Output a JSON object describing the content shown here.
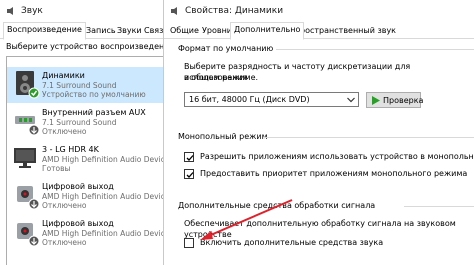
{
  "sound_window": {
    "title": "Звук",
    "tabs": [
      {
        "label": "Воспроизведение",
        "active": true
      },
      {
        "label": "Запись",
        "active": false
      },
      {
        "label": "Звуки",
        "active": false
      },
      {
        "label": "Связь",
        "active": false
      }
    ],
    "select_label": "Выберите устройство воспроизведения, па",
    "devices": [
      {
        "name": "Динамики",
        "line1": "7.1 Surround Sound",
        "line2": "Устройство по умолчанию",
        "icon": "speaker-icon",
        "selected": true
      },
      {
        "name": "Внутренний разъем AUX",
        "line1": "7.1 Surround Sound",
        "line2": "Отключено",
        "icon": "aux-icon",
        "selected": false
      },
      {
        "name": "3 - LG HDR 4K",
        "line1": "AMD High Definition Audio Device",
        "line2": "Готовы",
        "icon": "monitor-icon",
        "selected": false
      },
      {
        "name": "Цифровой выход",
        "line1": "AMD High Definition Audio Device",
        "line2": "Отключено",
        "icon": "digital-output-icon",
        "selected": false
      },
      {
        "name": "Цифровой выход",
        "line1": "AMD High Definition Audio Device",
        "line2": "Отключено",
        "icon": "digital-output-icon",
        "selected": false
      }
    ]
  },
  "props_window": {
    "title": "Свойства: Динамики",
    "tabs": [
      {
        "label": "Общие",
        "active": false
      },
      {
        "label": "Уровни",
        "active": false
      },
      {
        "label": "Дополнительно",
        "active": true
      },
      {
        "label": "Пространственный звук",
        "active": false
      }
    ],
    "default_format": {
      "title": "Формат по умолчанию",
      "description": [
        "Выберите разрядность и частоту дискретизации для использования",
        "в общем режиме."
      ],
      "selected_value": "16 бит, 48000 Гц (Диск DVD)",
      "test_button": "Проверка"
    },
    "exclusive_mode": {
      "title": "Монопольный режим",
      "options": [
        {
          "label": "Разрешить приложениям использовать устройство в монопольном режиме",
          "checked": true
        },
        {
          "label": "Предоставить приоритет приложениям монопольного режима",
          "checked": true
        }
      ]
    },
    "enhancements": {
      "title": "Дополнительные средства обработки сигнала",
      "description": "Обеспечивает дополнительную обработку сигнала на звуковом устройстве",
      "option": {
        "label": "Включить дополнительные средства звука",
        "checked": false
      }
    }
  },
  "colors": {
    "selection": "#cce8ff",
    "annotation_arrow": "#e0202a",
    "play_green": "#2a9d2a"
  }
}
